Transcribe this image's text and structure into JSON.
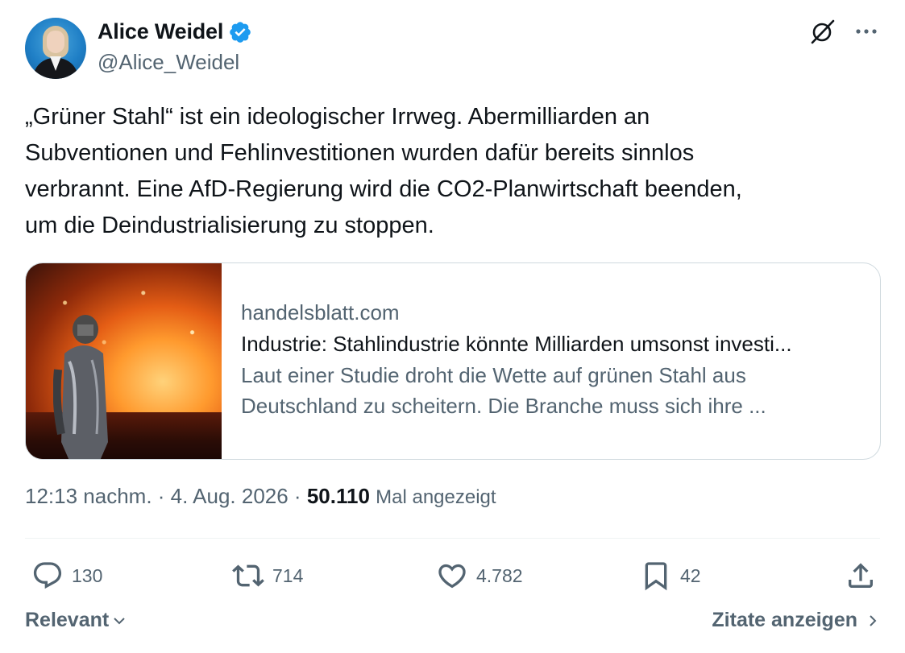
{
  "author": {
    "display_name": "Alice Weidel",
    "handle": "@Alice_Weidel",
    "verified": true
  },
  "icons": {
    "verified": "verified-badge-icon",
    "grok": "grok-icon",
    "more": "more-dots-icon",
    "reply": "reply-bubble-icon",
    "retweet": "retweet-icon",
    "like": "heart-icon",
    "bookmark": "bookmark-icon",
    "share": "share-upload-icon"
  },
  "tweet": {
    "text": "„Grüner Stahl“ ist ein ideologischer Irrweg. Abermilliarden an\nSubventionen und Fehlinvestitionen wurden dafür bereits sinnlos\nverbrannt. Eine AfD-Regierung wird die CO2-Planwirtschaft beenden,\num die Deindustrialisierung zu stoppen."
  },
  "link_card": {
    "domain": "handelsblatt.com",
    "title": "Industrie: Stahlindustrie könnte Milliarden umsonst investi...",
    "description": "Laut einer Studie droht die Wette auf grünen Stahl aus Deutschland zu scheitern. Die Branche muss sich ihre ..."
  },
  "meta": {
    "time": "12:13 nachm.",
    "separator": " · ",
    "date": "4. Aug. 2026",
    "views_count": "50.110",
    "views_label": "Mal angezeigt"
  },
  "actions": {
    "replies": "130",
    "retweets": "714",
    "likes": "4.782",
    "bookmarks": "42"
  },
  "footer": {
    "sort_label": "Relevant",
    "quotes_label": "Zitate anzeigen"
  },
  "colors": {
    "text_primary": "#0f1419",
    "text_secondary": "#536471",
    "verified_blue": "#1d9bf0",
    "border": "#cfd9de"
  }
}
